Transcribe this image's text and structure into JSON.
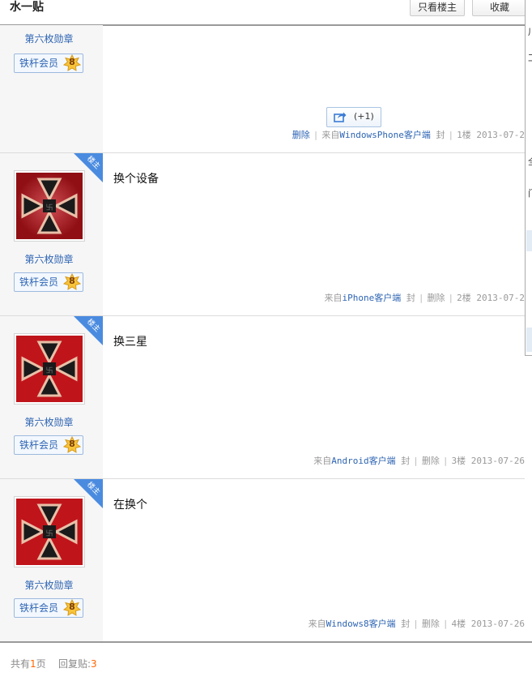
{
  "header": {
    "title": "水一贴",
    "only_owner_button": "只看楼主",
    "favorite_button": "收藏"
  },
  "edge_panel": {
    "chars": [
      "川",
      "工",
      "全",
      "门"
    ]
  },
  "posts": [
    {
      "medal": "第六枚勋章",
      "member": "铁杆会员",
      "level": "8",
      "share_count": "(+1)",
      "meta": {
        "delete": "删除",
        "from_prefix": "来自",
        "client": "WindowsPhone客户端",
        "ban": "封",
        "floor": "1楼",
        "date": "2013-07-2"
      }
    },
    {
      "medal": "第六枚勋章",
      "member": "铁杆会员",
      "level": "8",
      "corner": "楼主",
      "content": "换个设备",
      "meta": {
        "from_prefix": "来自",
        "client": "iPhone客户端",
        "ban": "封",
        "delete": "删除",
        "floor": "2楼",
        "date": "2013-07-2"
      }
    },
    {
      "medal": "第六枚勋章",
      "member": "铁杆会员",
      "level": "8",
      "corner": "楼主",
      "content": "换三星",
      "meta": {
        "from_prefix": "来自",
        "client": "Android客户端",
        "ban": "封",
        "delete": "删除",
        "floor": "3楼",
        "date": "2013-07-26"
      }
    },
    {
      "medal": "第六枚勋章",
      "member": "铁杆会员",
      "level": "8",
      "corner": "楼主",
      "content": "在换个",
      "meta": {
        "from_prefix": "来自",
        "client": "Windows8客户端",
        "ban": "封",
        "delete": "删除",
        "floor": "4楼",
        "date": "2013-07-26"
      }
    }
  ],
  "footer": {
    "pages_prefix": "共有",
    "pages_count": "1",
    "pages_suffix": "页",
    "replies_label": "回复贴:",
    "replies_count": "3"
  },
  "colors": {
    "link": "#2d64b3",
    "owner_corner": "#4a8be0",
    "count": "#ff6600"
  }
}
